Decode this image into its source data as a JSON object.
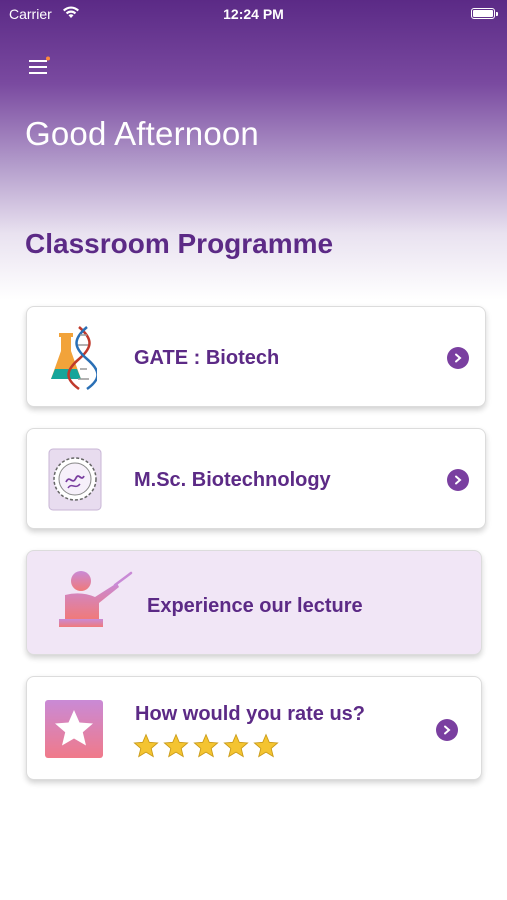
{
  "status_bar": {
    "carrier": "Carrier",
    "time": "12:24 PM"
  },
  "header": {
    "greeting": "Good Afternoon",
    "section_title": "Classroom Programme"
  },
  "cards": [
    {
      "label": "GATE : Biotech",
      "icon": "dna-flask-icon"
    },
    {
      "label": "M.Sc. Biotechnology",
      "icon": "cell-icon"
    },
    {
      "label": "Experience our lecture",
      "icon": "lecturer-icon"
    },
    {
      "label": "How would you rate us?",
      "icon": "star-badge-icon",
      "rating": 5
    }
  ],
  "colors": {
    "brand_purple": "#5c2a86",
    "chevron": "#7a3fa0",
    "lecture_card_bg": "#f1e6f6",
    "star": "#f4c430"
  }
}
